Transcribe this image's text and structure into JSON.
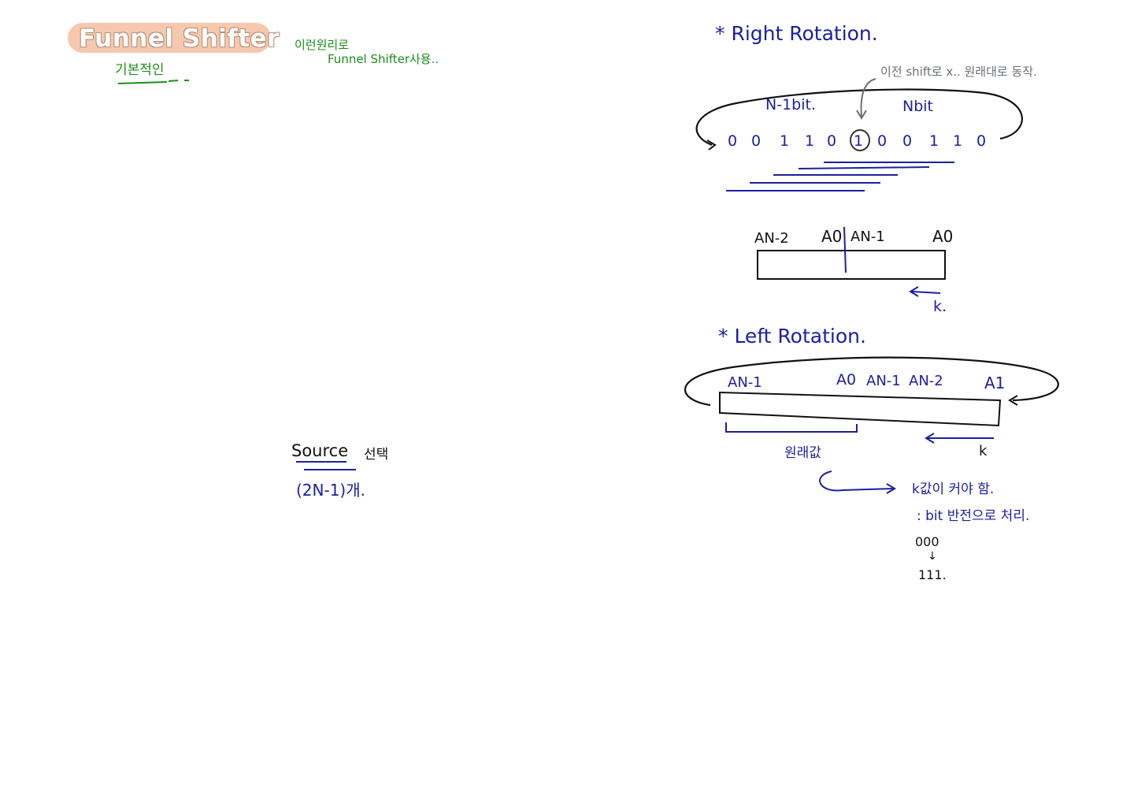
{
  "page_title": "Funnel Shifter",
  "colors": {
    "title_badge": "#f6c8ad",
    "green_ink": "#1a8f1a",
    "blue_ink": "#1b1fa3",
    "gray_ink": "#6b6f78",
    "black_ink": "#111111"
  },
  "notes_left": {
    "green_note_1": "기본적인",
    "green_note_2": "이런원리로",
    "green_note_3": "Funnel Shifter사용..",
    "source_label": "Source",
    "source_suffix": "선택",
    "source_count": "(2N-1)개."
  },
  "right_rotation": {
    "heading": "* Right Rotation.",
    "gray_note": "이전 shift로 x.. 원래대로 동작.",
    "label_left": "N-1bit.",
    "label_right": "Nbit",
    "bits": [
      "0",
      "0",
      "1",
      "1",
      "0",
      "1",
      "0",
      "0",
      "1",
      "1",
      "0"
    ],
    "box_labels": [
      "AN-2",
      "A0",
      "AN-1",
      "A0"
    ],
    "k_label": "k."
  },
  "left_rotation": {
    "heading": "* Left Rotation.",
    "box_labels": [
      "AN-1",
      "A0",
      "AN-1",
      "AN-2",
      "A1"
    ],
    "bracket_note": "원래값",
    "k_label": "k",
    "arrow_note": "k값이 커야 함.",
    "explain": ": bit 반전으로 처리.",
    "example_top": "000",
    "example_arrow": "↓",
    "example_bottom": "111."
  }
}
